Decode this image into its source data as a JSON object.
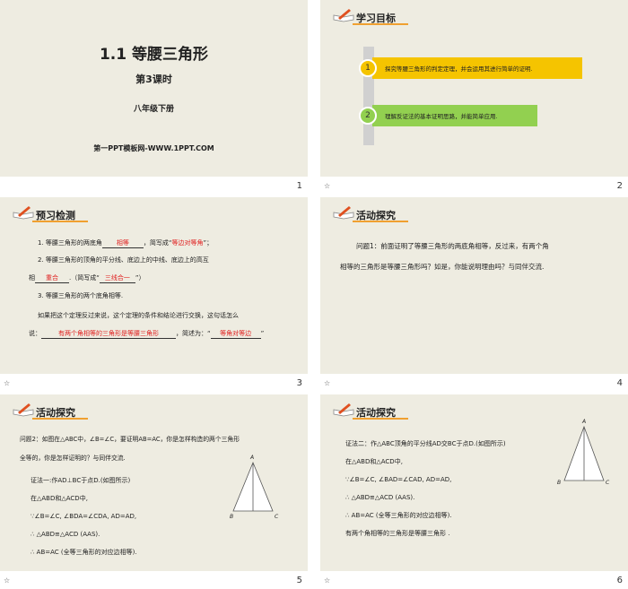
{
  "slide1": {
    "title": "1.1 等腰三角形",
    "subtitle": "第3课时",
    "grade": "八年级下册",
    "site": "第一PPT模板网-WWW.1PPT.COM",
    "number": "1"
  },
  "slide2": {
    "header": "学习目标",
    "goals": [
      {
        "index": "1",
        "text": "探究等腰三角形的判定定理，并会运用其进行简单的证明."
      },
      {
        "index": "2",
        "text": "理解反证法的基本证明思路，并能简单应用."
      }
    ],
    "number": "2"
  },
  "slide3": {
    "header": "预习检测",
    "line1_a": "1. 等腰三角形的两底角",
    "line1_ans1": "相等",
    "line1_b": "，简写成“",
    "line1_ans2": "等边对等角",
    "line1_c": "”；",
    "line2": "2. 等腰三角形的顶角的平分线、底边上的中线、底边上的高互",
    "line3_a": "相",
    "line3_ans": "重合",
    "line3_b": ".（简写成“",
    "line3_ans2": "三线合一",
    "line3_c": "”）",
    "line4": "3. 等腰三角形的两个底角相等.",
    "line5": "如果把这个定理反过来说，这个定理的条件和结论进行交换，这句话怎么",
    "line6_a": "说：",
    "line6_ans": "有两个角相等的三角形是等腰三角形",
    "line6_b": "，简述为：“",
    "line6_ans2": "等角对等边",
    "line6_c": "”",
    "number": "3"
  },
  "slide4": {
    "header": "活动探究",
    "line1": "问题1：前面证明了等腰三角形的两底角相等，反过来，有两个角",
    "line2": "相等的三角形是等腰三角形吗？如是，你能说明理由吗？与同伴交流.",
    "number": "4"
  },
  "slide5": {
    "header": "活动探究",
    "line1": "问题2：如图在△ABC中，∠B=∠C，要证明AB=AC，你是怎样构造的两个三角形",
    "line2": "全等的，你是怎样证明的？与同伴交流.",
    "proof": [
      "证法一:作AD⊥BC于点D.(如图所示)",
      "在△ABD和△ACD中,",
      "∵∠B=∠C, ∠BDA=∠CDA, AD=AD,",
      "∴ △ABD≌△ACD (AAS).",
      "∴ AB=AC (全等三角形的对应边相等)."
    ],
    "labels": {
      "a": "A",
      "b": "B",
      "c": "C"
    },
    "number": "5"
  },
  "slide6": {
    "header": "活动探究",
    "proof": [
      "证法二：作△ABC顶角的平分线AD交BC于点D.(如图所示)",
      "在△ABD和△ACD中,",
      "∵∠B=∠C, ∠BAD=∠CAD, AD=AD,",
      "∴ △ABD≌△ACD (AAS).",
      "∴ AB=AC (全等三角形的对应边相等).",
      "有两个角相等的三角形是等腰三角形 ."
    ],
    "labels": {
      "a": "A",
      "b": "B",
      "c": "C"
    },
    "number": "6"
  },
  "star": "☆"
}
